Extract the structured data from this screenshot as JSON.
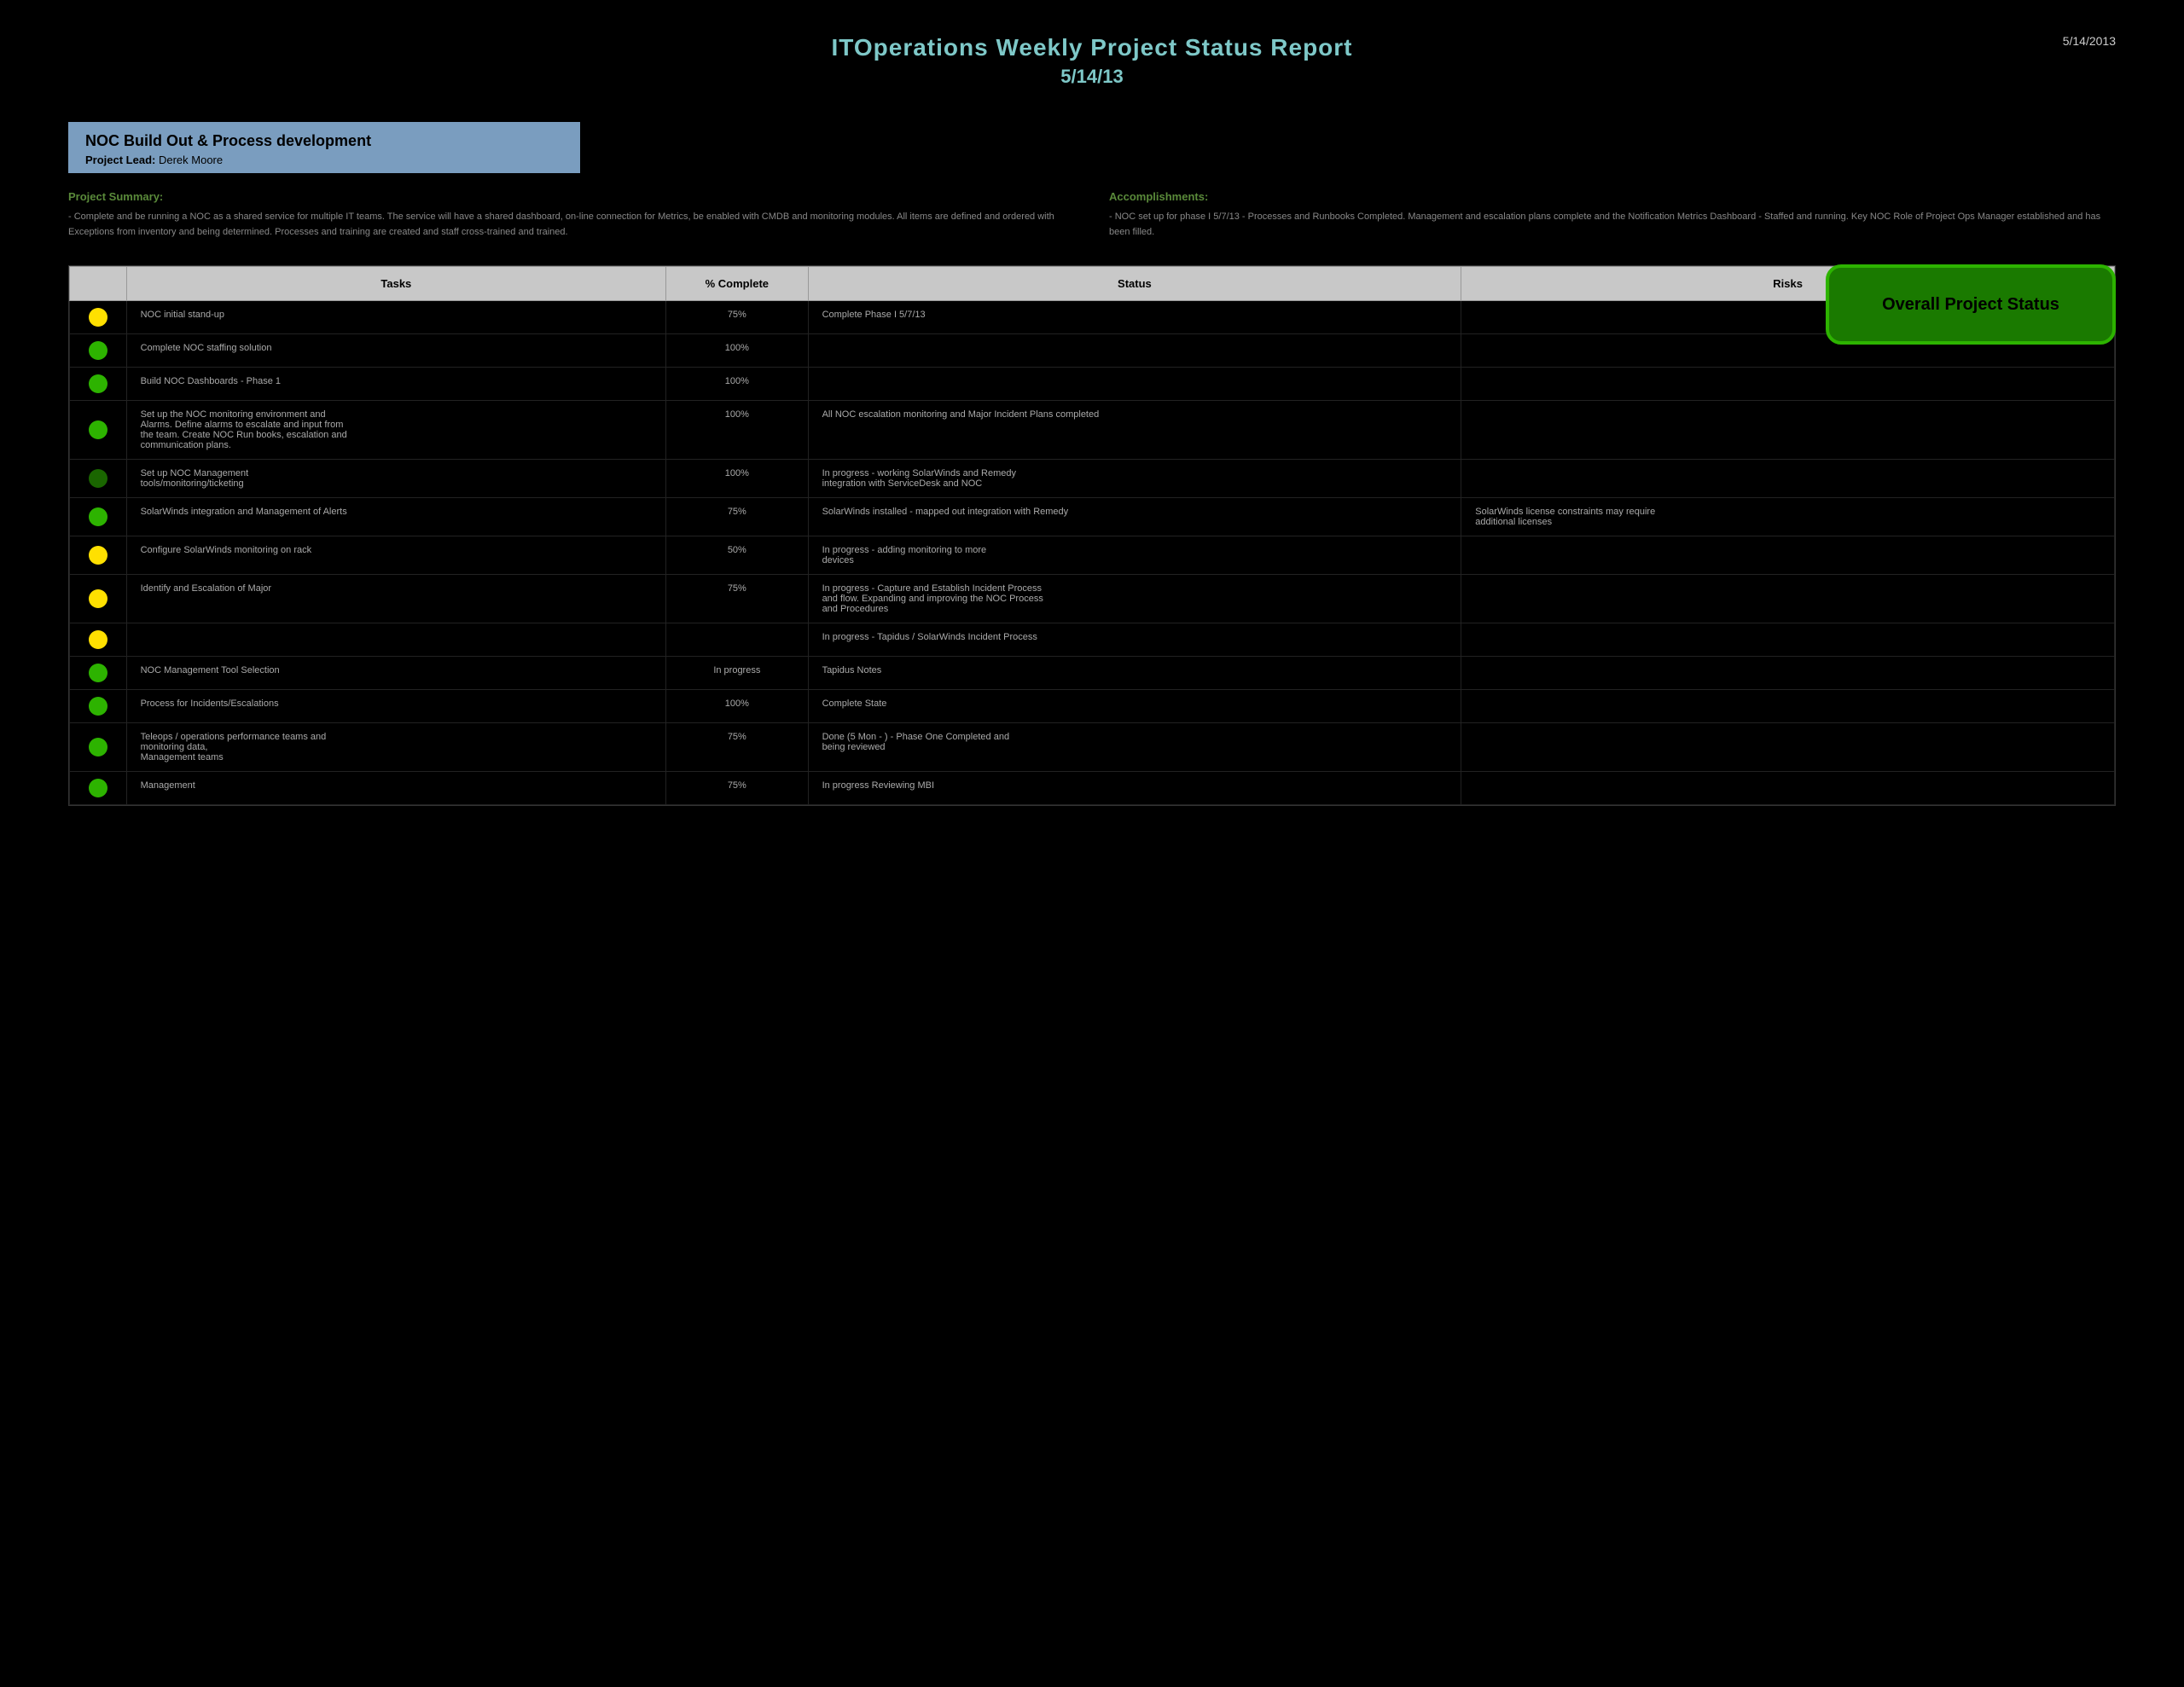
{
  "header": {
    "title": "ITOperations Weekly Project Status Report",
    "subtitle": "5/14/13",
    "date": "5/14/2013"
  },
  "project": {
    "name": "NOC Build Out & Process development",
    "lead_label": "Project Lead:",
    "lead_name": "Derek Moore"
  },
  "overall_status": {
    "label": "Overall Project Status"
  },
  "summary": {
    "left_header": "Project Summary:",
    "left_text": "- Complete and be running a NOC as a shared service for multiple\n  IT teams. The service will have a shared dashboard, on-line connection\n  for Metrics, be enabled with CMDB and monitoring modules. All items are\n  defined and ordered with Exceptions from inventory and being determined.\n  Processes and training are created and staff cross-trained and trained.",
    "right_header": "Accomplishments:",
    "right_text": "- NOC set up for phase I 5/7/13\n- Processes and Runbooks Completed. Management and\n  escalation plans complete and the Notification Metrics\n  Dashboard\n- Staffed and running. Key NOC Role of Project Ops\n  Manager established and has been filled."
  },
  "columns": {
    "tasks": "Tasks",
    "complete": "% Complete",
    "status": "Status",
    "risks": "Risks"
  },
  "rows": [
    {
      "indicator": "yellow",
      "task": "NOC initial stand-up",
      "complete": "75%",
      "status": "Complete Phase I 5/7/13",
      "risks": ""
    },
    {
      "indicator": "green",
      "task": "Complete NOC staffing solution",
      "complete": "100%",
      "status": "",
      "risks": ""
    },
    {
      "indicator": "green",
      "task": "Build NOC Dashboards - Phase 1",
      "complete": "100%",
      "status": "",
      "risks": ""
    },
    {
      "indicator": "green",
      "task": "Set up the NOC monitoring environment and\nAlarms. Define alarms to escalate and input from\nthe team. Create NOC Run books, escalation and\ncommunication plans.",
      "complete": "100%",
      "status": "All NOC escalation monitoring and Major Incident Plans completed",
      "risks": ""
    },
    {
      "indicator": "dark-green",
      "task": "Set up NOC Management\ntools/monitoring/ticketing",
      "complete": "100%",
      "status": "In progress - working SolarWinds and Remedy\nintegration with ServiceDesk and NOC",
      "risks": ""
    },
    {
      "indicator": "green",
      "task": "SolarWinds integration and Management of Alerts",
      "complete": "75%",
      "status": "SolarWinds installed - mapped out integration with Remedy",
      "risks": "SolarWinds license constraints may require\nadditional licenses"
    },
    {
      "indicator": "yellow",
      "task": "Configure SolarWinds monitoring on rack",
      "complete": "50%",
      "status": "In progress - adding monitoring to more\ndevices",
      "risks": ""
    },
    {
      "indicator": "yellow",
      "task": "Identify and Escalation of Major",
      "complete": "75%",
      "status": "In progress - Capture and Establish Incident Process\nand flow. Expanding and improving the NOC Process\nand Procedures",
      "risks": ""
    },
    {
      "indicator": "yellow",
      "task": "",
      "complete": "",
      "status": "In progress - Tapidus / SolarWinds Incident Process",
      "risks": ""
    },
    {
      "indicator": "green",
      "task": "NOC Management Tool Selection",
      "complete": "In progress",
      "status": "Tapidus Notes",
      "risks": ""
    },
    {
      "indicator": "green",
      "task": "Process for Incidents/Escalations",
      "complete": "100%",
      "status": "Complete State",
      "risks": ""
    },
    {
      "indicator": "green",
      "task": "Teleops / operations performance teams and\nmonitoring data,\nManagement teams",
      "complete": "75%",
      "status": "Done (5 Mon - ) - Phase One Completed and\nbeing reviewed",
      "risks": ""
    },
    {
      "indicator": "green",
      "task": "Management",
      "complete": "75%",
      "status": "In progress Reviewing MBI",
      "risks": ""
    }
  ]
}
